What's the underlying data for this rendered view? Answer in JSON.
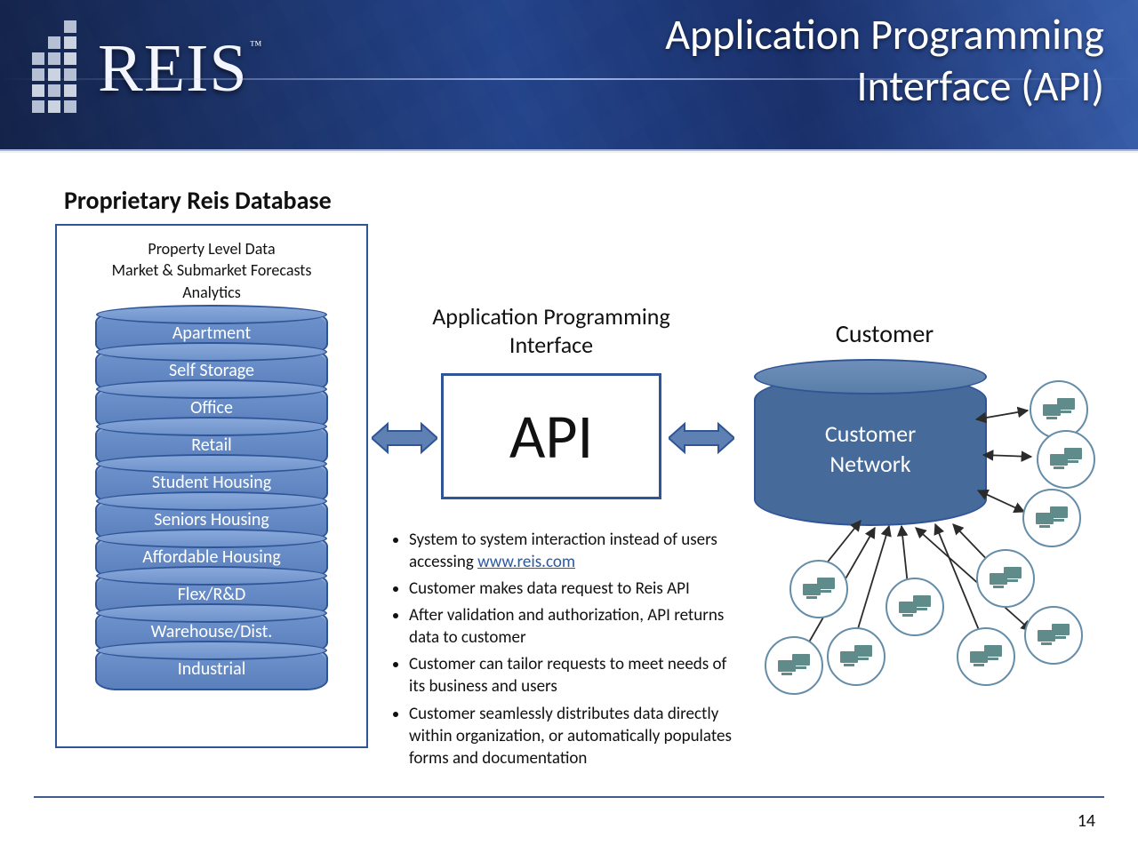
{
  "header": {
    "brand": "REIS",
    "title_line_1": "Application Programming",
    "title_line_2": "Interface (API)"
  },
  "database": {
    "title": "Proprietary Reis Database",
    "caption_lines": [
      "Property Level Data",
      "Market & Submarket Forecasts",
      "Analytics"
    ],
    "stack": [
      "Apartment",
      "Self Storage",
      "Office",
      "Retail",
      "Student Housing",
      "Seniors Housing",
      "Affordable Housing",
      "Flex/R&D",
      "Warehouse/Dist.",
      "Industrial"
    ]
  },
  "api": {
    "title": "Application Programming Interface",
    "box_label": "API",
    "bullets": [
      "System to system interaction instead of users accessing <a href=\"#\">www.reis.com</a>",
      "Customer makes data request to Reis API",
      "After validation and authorization, API returns data to customer",
      "Customer can tailor requests to meet needs of its business and users",
      "Customer seamlessly distributes data directly within organization, or automatically populates forms and documentation"
    ]
  },
  "customer": {
    "title": "Customer",
    "cyl_line_1": "Customer",
    "cyl_line_2": "Network"
  },
  "page": "14",
  "colors": {
    "accent": "#2f5597",
    "disk_fill": "#5a80bd",
    "cyl_fill": "#466a99",
    "node_stroke": "#668da7",
    "arrow": "#5e80b2"
  }
}
